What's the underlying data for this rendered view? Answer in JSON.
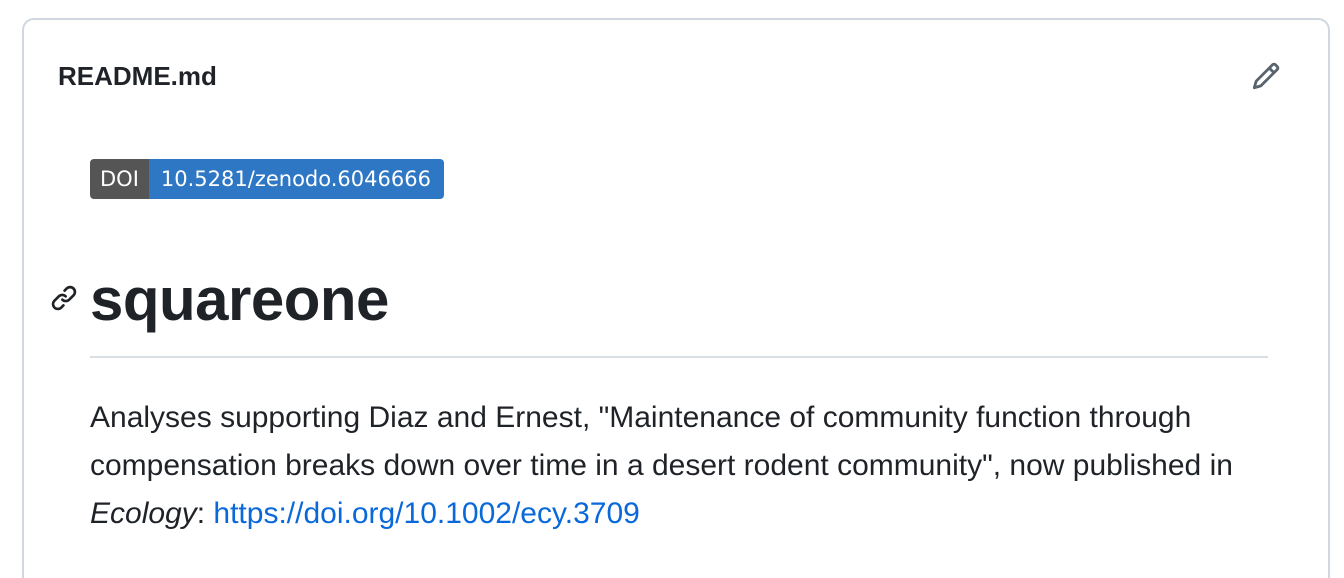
{
  "readme": {
    "filename": "README.md",
    "edit_icon": "pencil-icon",
    "anchor_icon": "link-icon"
  },
  "badge": {
    "label": "DOI",
    "value": "10.5281/zenodo.6046666",
    "label_color": "#555555",
    "value_color": "#2d77c4"
  },
  "content": {
    "title": "squareone",
    "description_part1": "Analyses supporting Diaz and Ernest, \"Maintenance of community function through compensation breaks down over time in a desert rodent community\", now published in ",
    "journal": "Ecology",
    "separator": ": ",
    "link_text": "https://doi.org/10.1002/ecy.3709"
  },
  "colors": {
    "text": "#1f2328",
    "link": "#0969da",
    "border": "#d0d7de",
    "icon": "#59636e"
  }
}
